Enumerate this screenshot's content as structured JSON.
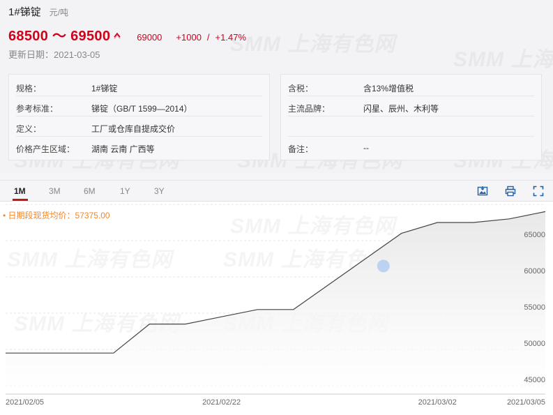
{
  "product": {
    "title": "1#锑锭",
    "unit": "元/吨",
    "price_range": "68500 ～ 69500",
    "prev_price": "69000",
    "change": "+1000",
    "separator": "/",
    "change_pct": "+1.47%",
    "trend_icon": "up-arrow-icon",
    "updated": "更新日期：2021-03-05"
  },
  "specs_left": [
    {
      "label": "规格：",
      "value": "1#锑锭"
    },
    {
      "label": "参考标准：",
      "value": "锑锭（GB/T 1599—2014）"
    },
    {
      "label": "定义：",
      "value": "工厂或仓库自提成交价"
    },
    {
      "label": "价格产生区域：",
      "value": "湖南 云南 广西等"
    }
  ],
  "specs_right": [
    {
      "label": "含税：",
      "value": "含13%增值税"
    },
    {
      "label": "主流品牌：",
      "value": "闪星、辰州、木利等"
    },
    {
      "label": "",
      "value": ""
    },
    {
      "label": "备注：",
      "value": "--"
    }
  ],
  "tabs": [
    "1M",
    "3M",
    "6M",
    "1Y",
    "3Y"
  ],
  "active_tab": "1M",
  "toolbar": {
    "icons": [
      "image-download-icon",
      "print-icon",
      "fullscreen-icon"
    ]
  },
  "watermark": "SMM 上海有色网",
  "chart_avg_label": "• 日期段现货均价：57375.00",
  "colors": {
    "price_red": "#d0021b",
    "line": "#444444",
    "area_fill": "#e8e8e8",
    "avg_label": "#f0872a",
    "tab_underline": "#c01818",
    "highlight_dot": "#a9c8f0"
  },
  "chart_data": {
    "type": "area",
    "x": [
      "2021/02/05",
      "2021/02/08",
      "2021/02/09",
      "2021/02/10",
      "2021/02/18",
      "2021/02/19",
      "2021/02/22",
      "2021/02/23",
      "2021/02/24",
      "2021/02/25",
      "2021/02/26",
      "2021/03/01",
      "2021/03/02",
      "2021/03/03",
      "2021/03/04",
      "2021/03/05"
    ],
    "values": [
      49500,
      49500,
      49500,
      49500,
      53500,
      53500,
      54500,
      55500,
      55500,
      59000,
      62500,
      66000,
      67500,
      67500,
      68000,
      69000
    ],
    "x_tick_labels": [
      "2021/02/05",
      "2021/02/22",
      "2021/03/02",
      "2021/03/05"
    ],
    "y_ticks": [
      45000,
      50000,
      55000,
      60000,
      65000
    ],
    "ylim": [
      44000,
      70000
    ],
    "y_axis_position": "right",
    "grid": true,
    "highlight": {
      "x": "2021/02/26",
      "value": 61500
    },
    "title": "",
    "xlabel": "",
    "ylabel": ""
  }
}
